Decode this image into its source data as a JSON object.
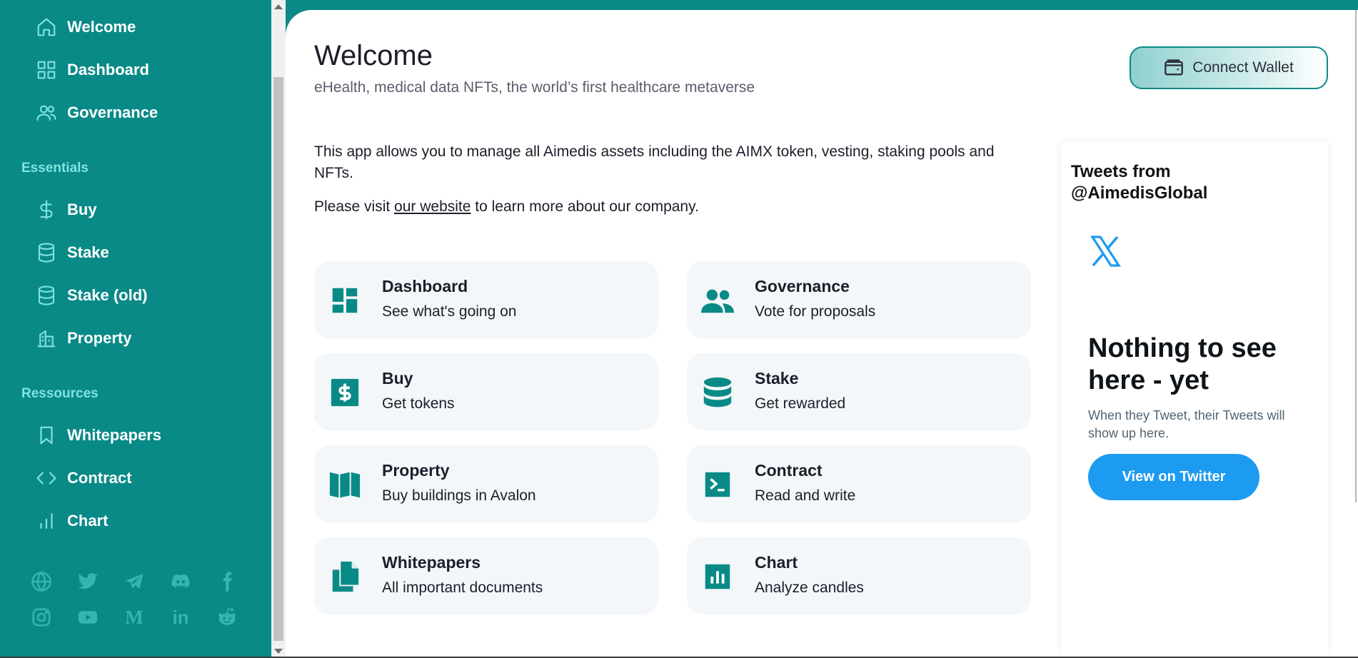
{
  "colors": {
    "sidebar": "#0a8a87",
    "accent_icon": "#7fe3df",
    "card_icon": "#0a8a87",
    "twitter_blue": "#1d9bf0"
  },
  "sidebar": {
    "main_items": [
      {
        "label": "Welcome",
        "icon": "home-icon"
      },
      {
        "label": "Dashboard",
        "icon": "grid-icon"
      },
      {
        "label": "Governance",
        "icon": "users-icon"
      }
    ],
    "essentials_title": "Essentials",
    "essentials_items": [
      {
        "label": "Buy",
        "icon": "dollar-icon"
      },
      {
        "label": "Stake",
        "icon": "database-icon"
      },
      {
        "label": "Stake (old)",
        "icon": "database-icon"
      },
      {
        "label": "Property",
        "icon": "building-icon"
      }
    ],
    "resources_title": "Ressources",
    "resources_items": [
      {
        "label": "Whitepapers",
        "icon": "bookmark-icon"
      },
      {
        "label": "Contract",
        "icon": "code-icon"
      },
      {
        "label": "Chart",
        "icon": "bar-chart-icon"
      }
    ],
    "social_icons": [
      "globe-icon",
      "twitter-icon",
      "telegram-icon",
      "discord-icon",
      "facebook-icon",
      "instagram-icon",
      "youtube-icon",
      "medium-icon",
      "linkedin-icon",
      "reddit-icon"
    ],
    "medium_letter": "M",
    "linkedin_letters": "in"
  },
  "header": {
    "title": "Welcome",
    "subtitle": "eHealth, medical data NFTs, the world’s first healthcare metaverse",
    "connect_wallet": "Connect Wallet"
  },
  "intro": {
    "paragraph1": "This app allows you to manage all Aimedis assets including the AIMX token, vesting, staking pools and NFTs.",
    "paragraph2_before": "Please visit ",
    "paragraph2_link": "our website",
    "paragraph2_after": " to learn more about our company."
  },
  "cards": [
    {
      "title": "Dashboard",
      "desc": "See what's going on",
      "icon": "dashboard-icon"
    },
    {
      "title": "Governance",
      "desc": "Vote for proposals",
      "icon": "people-icon"
    },
    {
      "title": "Buy",
      "desc": "Get tokens",
      "icon": "dollar-box-icon"
    },
    {
      "title": "Stake",
      "desc": "Get rewarded",
      "icon": "database-icon"
    },
    {
      "title": "Property",
      "desc": "Buy buildings in Avalon",
      "icon": "map-icon"
    },
    {
      "title": "Contract",
      "desc": "Read and write",
      "icon": "terminal-icon"
    },
    {
      "title": "Whitepapers",
      "desc": "All important documents",
      "icon": "documents-icon"
    },
    {
      "title": "Chart",
      "desc": "Analyze candles",
      "icon": "chart-box-icon"
    }
  ],
  "twitter": {
    "heading": "Tweets from @AimedisGlobal",
    "empty_title": "Nothing to see here - yet",
    "empty_desc": "When they Tweet, their Tweets will show up here.",
    "view_button": "View on Twitter"
  }
}
